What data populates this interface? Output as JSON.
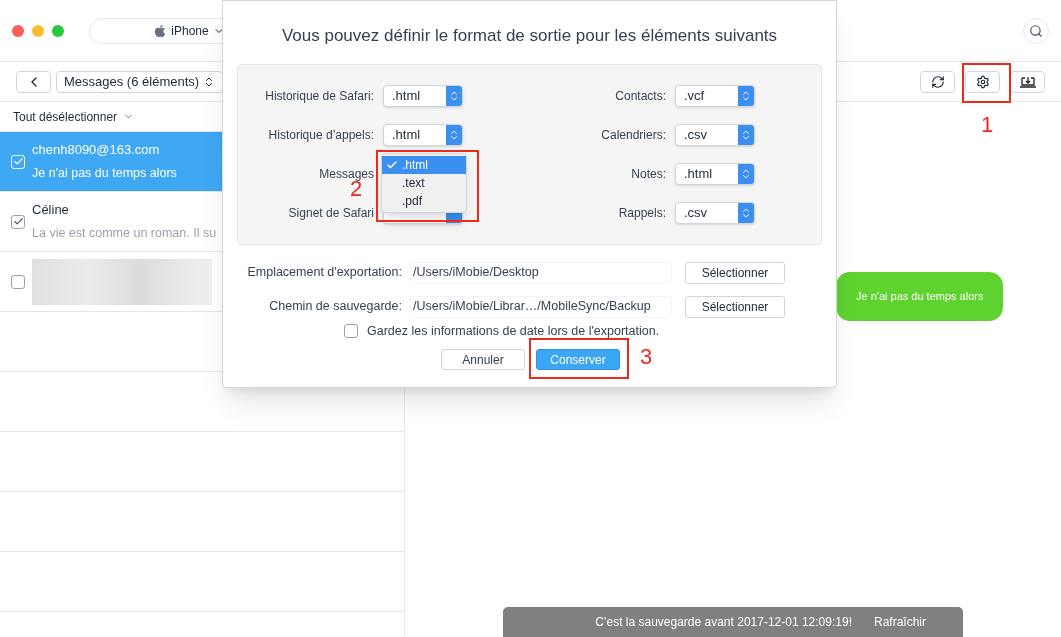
{
  "window": {
    "device": "iPhone"
  },
  "toolbar": {
    "category": "Messages (6 éléments)"
  },
  "list": {
    "select_all": "Tout désélectionner",
    "items": [
      {
        "kind": "message",
        "title": "chenh8090@163.com",
        "preview": "Je n'ai pas du temps alors",
        "checked": true,
        "selected": true
      },
      {
        "kind": "message",
        "title": "Céline",
        "preview": "La vie est comme un roman. Il su",
        "checked": true,
        "selected": false
      },
      {
        "kind": "blurred",
        "checked": false,
        "selected": false
      }
    ]
  },
  "conversation": {
    "bubble": "Je n'ai pas du temps alors"
  },
  "dialog": {
    "title": "Vous pouvez définir le format de sortie pour les éléments suivants",
    "left_column": [
      {
        "kind": "select",
        "label": "Historique de Safari:",
        "value": ".html"
      },
      {
        "kind": "select",
        "label": "Historique d’appels:",
        "value": ".html"
      },
      {
        "kind": "dropdown",
        "label": "Messages",
        "options": [
          {
            "label": ".html",
            "selected": true
          },
          {
            "label": ".text",
            "selected": false
          },
          {
            "label": ".pdf",
            "selected": false
          }
        ]
      },
      {
        "kind": "select",
        "label": "Signet de Safari"
      }
    ],
    "right_column": [
      {
        "kind": "select",
        "label": "Contacts:",
        "value": ".vcf"
      },
      {
        "kind": "select",
        "label": "Calendriers:",
        "value": ".csv"
      },
      {
        "kind": "select",
        "label": "Notes:",
        "value": ".html"
      },
      {
        "kind": "select",
        "label": "Rappels:",
        "value": ".csv"
      }
    ],
    "paths": [
      {
        "label": "Emplacement d'exportation:",
        "value": "/Users/iMobie/Desktop",
        "button": "Sélectionner"
      },
      {
        "label": "Chemin de sauvegarde:",
        "value": "/Users/iMobie/Librar…/MobileSync/Backup",
        "button": "Sélectionner"
      }
    ],
    "keep_dates": {
      "label": "Gardez les informations de date lors de l'exportation.",
      "checked": false
    },
    "buttons": [
      {
        "label": "Annuler",
        "kind": "secondary"
      },
      {
        "label": "Conserver",
        "kind": "primary"
      }
    ]
  },
  "toast": {
    "message": "C’est la sauvegarde avant 2017-12-01 12:09:19!",
    "action": "Rafraîchir"
  },
  "annotations": [
    {
      "label": "1"
    },
    {
      "label": "2"
    },
    {
      "label": "3"
    }
  ]
}
